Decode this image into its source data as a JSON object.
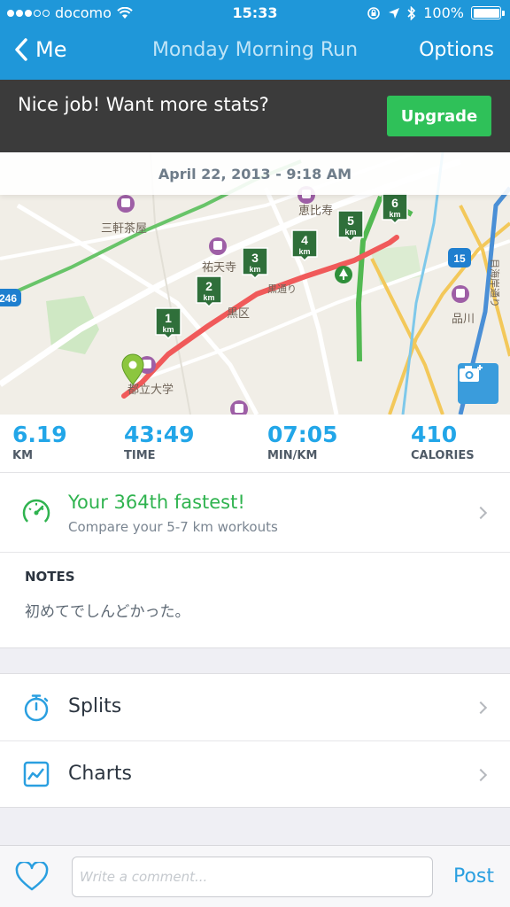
{
  "status_bar": {
    "carrier": "docomo",
    "time": "15:33",
    "battery": "100%",
    "signal_bars": [
      true,
      true,
      true,
      false,
      false
    ]
  },
  "nav": {
    "back_label": "Me",
    "title": "Monday Morning Run",
    "options_label": "Options"
  },
  "promo": {
    "text": "Nice job! Want more stats?",
    "button_label": "Upgrade"
  },
  "map": {
    "date_text": "April 22, 2013 - 9:18 AM",
    "place_labels": [
      "三軒茶屋",
      "恵比寿",
      "祐天寺",
      "黒区",
      "都立大学",
      "品川",
      "黒通り",
      "目海岸通り"
    ],
    "road_shields": [
      "246",
      "15"
    ],
    "km_markers": [
      {
        "num": "1",
        "unit": "km"
      },
      {
        "num": "2",
        "unit": "km"
      },
      {
        "num": "3",
        "unit": "km"
      },
      {
        "num": "4",
        "unit": "km"
      },
      {
        "num": "5",
        "unit": "km"
      },
      {
        "num": "6",
        "unit": "km"
      }
    ],
    "route_color": "#f05a5a"
  },
  "stats": [
    {
      "value": "6.19",
      "label": "KM"
    },
    {
      "value": "43:49",
      "label": "TIME"
    },
    {
      "value": "07:05",
      "label": "MIN/KM"
    },
    {
      "value": "410",
      "label": "CALORIES"
    }
  ],
  "fastest": {
    "title": "Your 364th fastest!",
    "subtitle": "Compare your 5-7 km workouts"
  },
  "notes": {
    "heading": "NOTES",
    "body": "初めてでしんどかった。"
  },
  "list": {
    "splits_label": "Splits",
    "charts_label": "Charts"
  },
  "comment": {
    "placeholder": "Write a comment...",
    "post_label": "Post"
  },
  "colors": {
    "nav_blue": "#1f97d9",
    "accent_green": "#2fc159",
    "stat_blue": "#22a6e8"
  }
}
